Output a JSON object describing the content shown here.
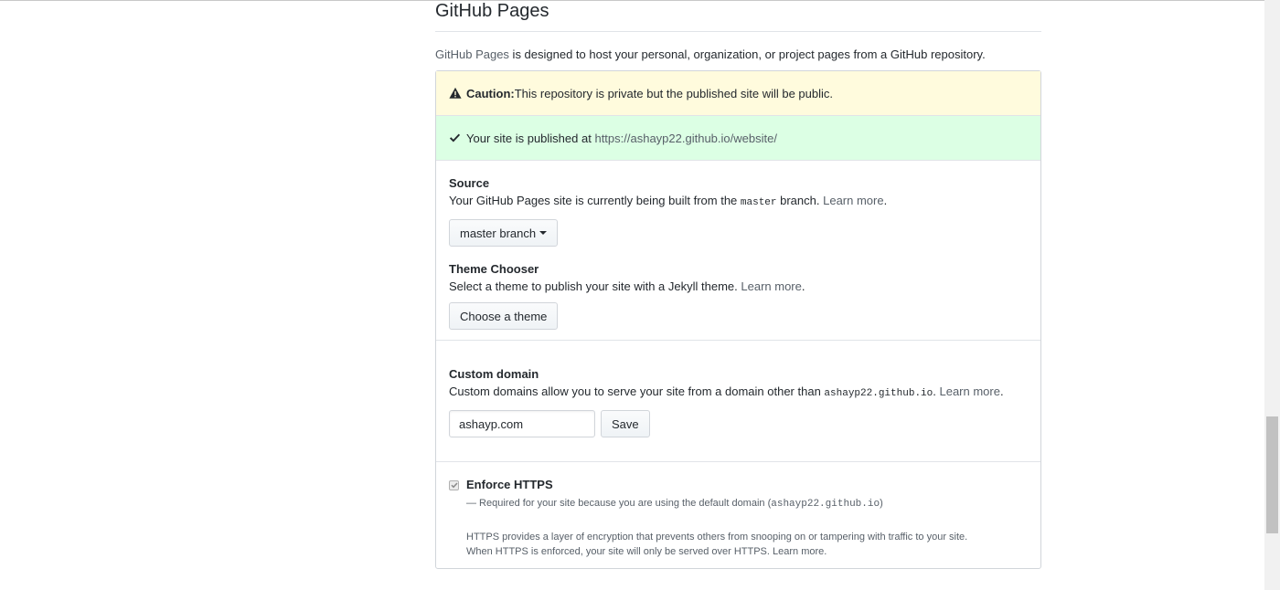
{
  "page": {
    "title": "GitHub Pages",
    "desc_link": "GitHub Pages",
    "desc_rest": " is designed to host your personal, organization, or project pages from a GitHub repository."
  },
  "caution": {
    "icon": "alert-icon",
    "label": "Caution:",
    "text": " This repository is private but the published site will be public."
  },
  "published": {
    "icon": "check-icon",
    "text": "Your site is published at ",
    "url": "https://ashayp22.github.io/website/"
  },
  "source": {
    "heading": "Source",
    "text_before": "Your GitHub Pages site is currently being built from the ",
    "branch_code": "master",
    "text_after": " branch. ",
    "learn_more": "Learn more",
    "period": ".",
    "button_label": "master branch"
  },
  "theme": {
    "heading": "Theme Chooser",
    "text": "Select a theme to publish your site with a Jekyll theme. ",
    "learn_more": "Learn more",
    "period": ".",
    "button_label": "Choose a theme"
  },
  "domain": {
    "heading": "Custom domain",
    "text_before": "Custom domains allow you to serve your site from a domain other than ",
    "domain_code": "ashayp22.github.io",
    "text_after": ". ",
    "learn_more": "Learn more",
    "period": ".",
    "input_value": "ashayp.com",
    "save_label": "Save"
  },
  "https": {
    "label": "Enforce HTTPS",
    "checked": true,
    "note_before": "— Required for your site because you are using the default domain (",
    "note_code": "ashayp22.github.io",
    "note_after": ")",
    "info_line1": "HTTPS provides a layer of encryption that prevents others from snooping on or tampering with traffic to your site.",
    "info_line2": "When HTTPS is enforced, your site will only be served over HTTPS. ",
    "learn_more": "Learn more",
    "period": "."
  },
  "colors": {
    "warn_bg": "#fffbdd",
    "success_bg": "#dcffe4",
    "link": "#0366d6"
  }
}
